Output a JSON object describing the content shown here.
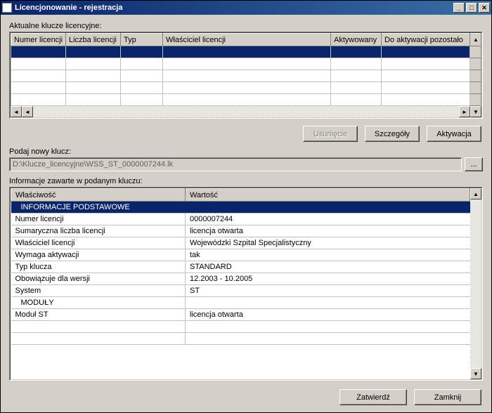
{
  "window": {
    "title": "Licencjonowanie - rejestracja"
  },
  "section1": {
    "label": "Aktualne klucze licencyjne:",
    "columns": {
      "c0": "Numer licencji",
      "c1": "Liczba licencji",
      "c2": "Typ",
      "c3": "Właściciel licencji",
      "c4": "Aktywowany",
      "c5": "Do aktywacji pozostało"
    }
  },
  "buttons1": {
    "remove": "Usunięcie",
    "details": "Szczegóły",
    "activate": "Aktywacja"
  },
  "new_key": {
    "label": "Podaj nowy klucz:",
    "value": "D:\\Klucze_licencyjne\\WSS_ST_0000007244.lk",
    "browse": "..."
  },
  "section2": {
    "label": "Informacje zawarte w podanym kluczu:",
    "columns": {
      "prop": "Właściwość",
      "val": "Wartość"
    },
    "rows": [
      {
        "type": "header",
        "prop": "INFORMACJE PODSTAWOWE",
        "val": ""
      },
      {
        "type": "data",
        "prop": "Numer licencji",
        "val": "0000007244"
      },
      {
        "type": "data",
        "prop": "Sumaryczna liczba licencji",
        "val": " licencja otwarta"
      },
      {
        "type": "data",
        "prop": "Właściciel licencji",
        "val": "Wojewódzki Szpital Specjalistyczny"
      },
      {
        "type": "data",
        "prop": "Wymaga aktywacji",
        "val": "tak"
      },
      {
        "type": "data",
        "prop": "Typ klucza",
        "val": "STANDARD"
      },
      {
        "type": "data",
        "prop": "Obowiązuje dla wersji",
        "val": "12.2003 - 10.2005"
      },
      {
        "type": "data",
        "prop": "System",
        "val": "ST"
      },
      {
        "type": "group",
        "prop": "MODUŁY",
        "val": ""
      },
      {
        "type": "data",
        "prop": "Moduł ST",
        "val": "licencja otwarta"
      }
    ]
  },
  "buttons2": {
    "confirm": "Zatwierdź",
    "close": "Zamknij"
  }
}
